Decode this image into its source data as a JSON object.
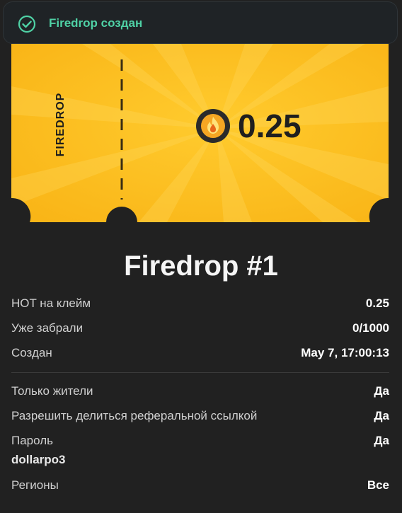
{
  "toast": {
    "message": "Firedrop создан",
    "icon": "check-circle-icon",
    "accent": "#4fd1a5"
  },
  "ticket": {
    "stub_label": "FIREDROP",
    "amount": "0.25",
    "coin_icon": "flame-coin-icon",
    "color": "#ffc21f"
  },
  "title": "Firedrop #1",
  "stats": [
    {
      "label": "HOT на клейм",
      "value": "0.25"
    },
    {
      "label": "Уже забрали",
      "value": "0/1000"
    },
    {
      "label": "Создан",
      "value": "May 7, 17:00:13"
    }
  ],
  "settings": {
    "residents_only": {
      "label": "Только жители",
      "value": "Да"
    },
    "referral_share": {
      "label": "Разрешить делиться реферальной ссылкой",
      "value": "Да"
    },
    "password": {
      "label": "Пароль",
      "value": "Да",
      "secret": "dollarpo3"
    },
    "regions": {
      "label": "Регионы",
      "value": "Все"
    }
  }
}
